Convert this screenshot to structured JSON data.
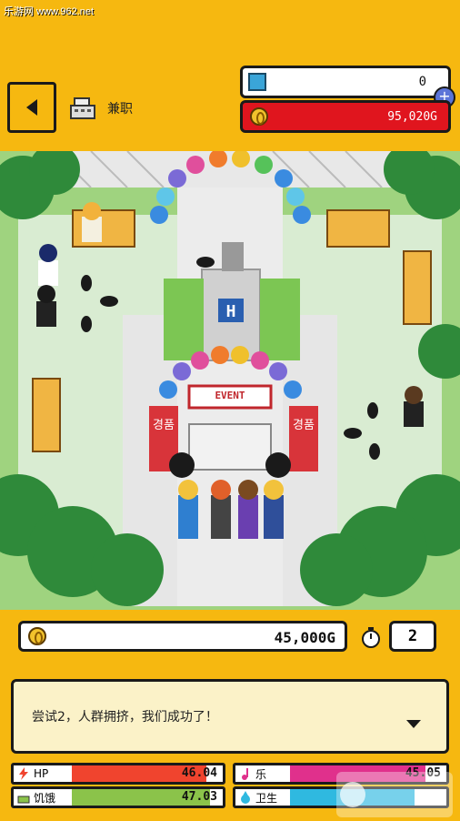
{
  "watermark": "乐游网 www.962.net",
  "header": {
    "job_label": "兼职",
    "gems": "0",
    "gold": "95,020G"
  },
  "scene": {
    "event_sign": "EVENT",
    "banner_left": "경품",
    "banner_right": "경품"
  },
  "status": {
    "money": "45,000G",
    "timer": "2"
  },
  "dialog": {
    "text": "尝试2，人群拥挤，我们成功了！"
  },
  "stats": {
    "hp": {
      "label": "HP",
      "value": "46.04",
      "level": 0.92,
      "color": "#F0442E"
    },
    "hunger": {
      "label": "饥饿",
      "value": "47.03",
      "level": 0.94,
      "color": "#8BC34A"
    },
    "fun": {
      "label": "乐",
      "value": "45.05",
      "level": 0.9,
      "color": "#E0308C"
    },
    "hygiene": {
      "label": "卫生",
      "value": "",
      "level": 0.85,
      "color": "#2FB9E0"
    }
  },
  "watermark_logo": "962.NET 乐游网",
  "colors": {
    "accent": "#F6B810",
    "gold_bar": "#E0151E"
  }
}
